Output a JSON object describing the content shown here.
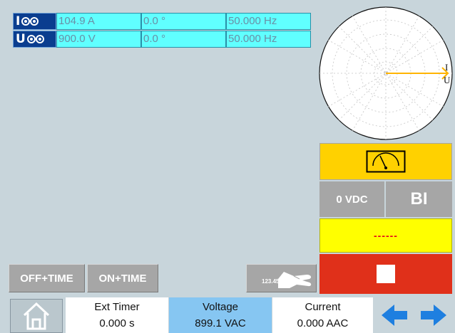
{
  "measurements": [
    {
      "letter": "I",
      "icon": "current-source-icon",
      "amplitude": "104.9 A",
      "phase": "0.0 °",
      "frequency": "50.000 Hz"
    },
    {
      "letter": "U",
      "icon": "voltage-source-icon",
      "amplitude": "900.0 V",
      "phase": "0.0 °",
      "frequency": "50.000 Hz"
    }
  ],
  "phasor": {
    "current_label": "I",
    "voltage_label": "U",
    "current_color": "#ffb400"
  },
  "right_panel": {
    "meter_icon": "analog-meter-icon",
    "dc_voltage": "0 VDC",
    "binary_input": "BI",
    "status": "------",
    "stop_icon": "stop-icon"
  },
  "mode_buttons": {
    "off_time": "OFF+TIME",
    "on_time": "ON+TIME",
    "keypad_value": "123.45",
    "keypad_icon": "hand-keypad-icon"
  },
  "bottom_bar": {
    "home_icon": "home-icon",
    "ext_timer": {
      "label": "Ext Timer",
      "value": "0.000 s"
    },
    "voltage": {
      "label": "Voltage",
      "value": "899.1 VAC"
    },
    "current": {
      "label": "Current",
      "value": "0.000 AAC"
    },
    "prev_icon": "arrow-left-icon",
    "next_icon": "arrow-right-icon"
  },
  "colors": {
    "background": "#c8d5db",
    "cyan_cell": "#60ffff",
    "cell_text": "#6a8fa6",
    "icon_blue": "#0a3d8f",
    "meter_yellow": "#ffd100",
    "status_yellow": "#ffff00",
    "stop_red": "#e0301a",
    "voltage_highlight": "#86c6f2",
    "arrow_blue": "#1e7fe0"
  }
}
